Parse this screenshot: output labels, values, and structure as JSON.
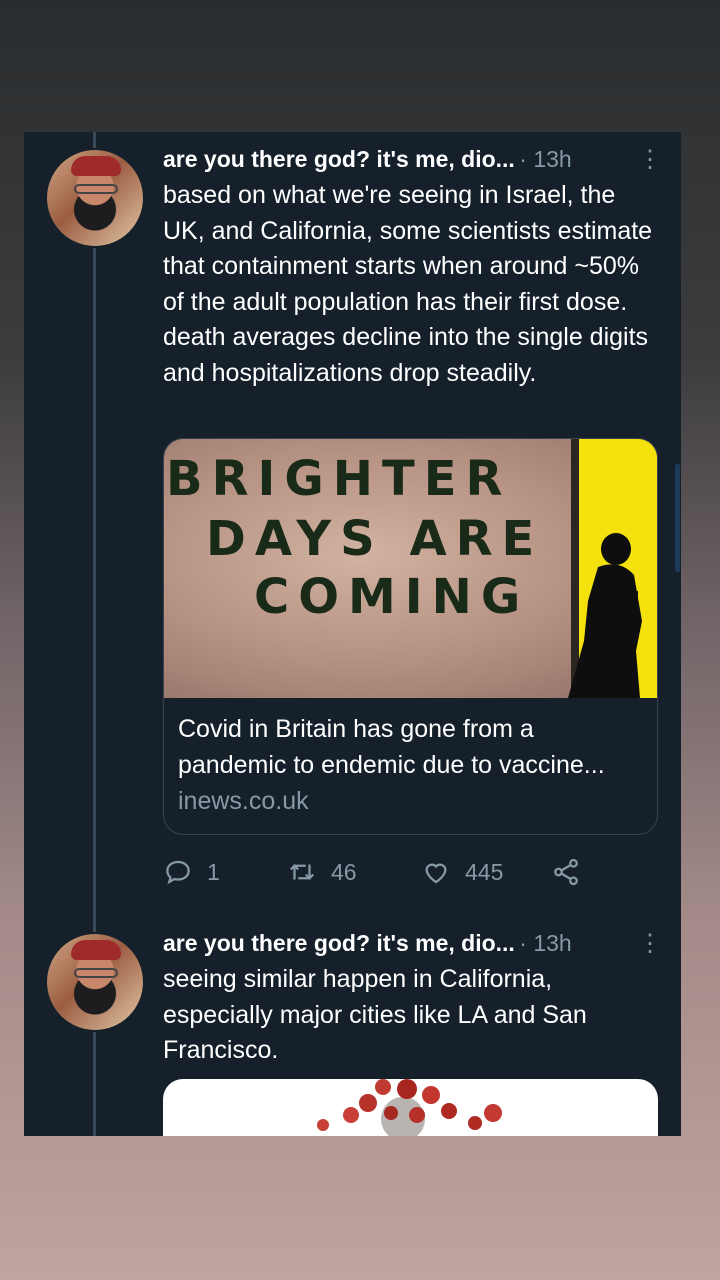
{
  "tweets": [
    {
      "display_name": "are you there god? it's me, dio...",
      "timestamp": "· 13h",
      "text": "based on what we're seeing in Israel, the UK, and California, some scientists estimate that containment starts when around ~50% of the adult population has their first dose. death averages decline into the single digits and hospitalizations drop steadily.",
      "link_card": {
        "image_text": [
          "BRIGHTER",
          "DAYS ARE",
          "COMING"
        ],
        "title": "Covid in Britain has gone from a pandemic to endemic due to vaccine...",
        "domain": "inews.co.uk"
      },
      "actions": {
        "replies": "1",
        "retweets": "46",
        "likes": "445"
      }
    },
    {
      "display_name": "are you there god? it's me, dio...",
      "timestamp": "· 13h",
      "text": "seeing similar happen in California, especially major cities like LA and San Francisco."
    }
  ],
  "icons": [
    "more-icon",
    "reply-icon",
    "retweet-icon",
    "like-icon",
    "share-icon",
    "avatar"
  ],
  "colors": {
    "card_background": "#15202b",
    "primary_text": "#ffffff",
    "secondary_text": "#8899a6",
    "border": "#38444d"
  }
}
